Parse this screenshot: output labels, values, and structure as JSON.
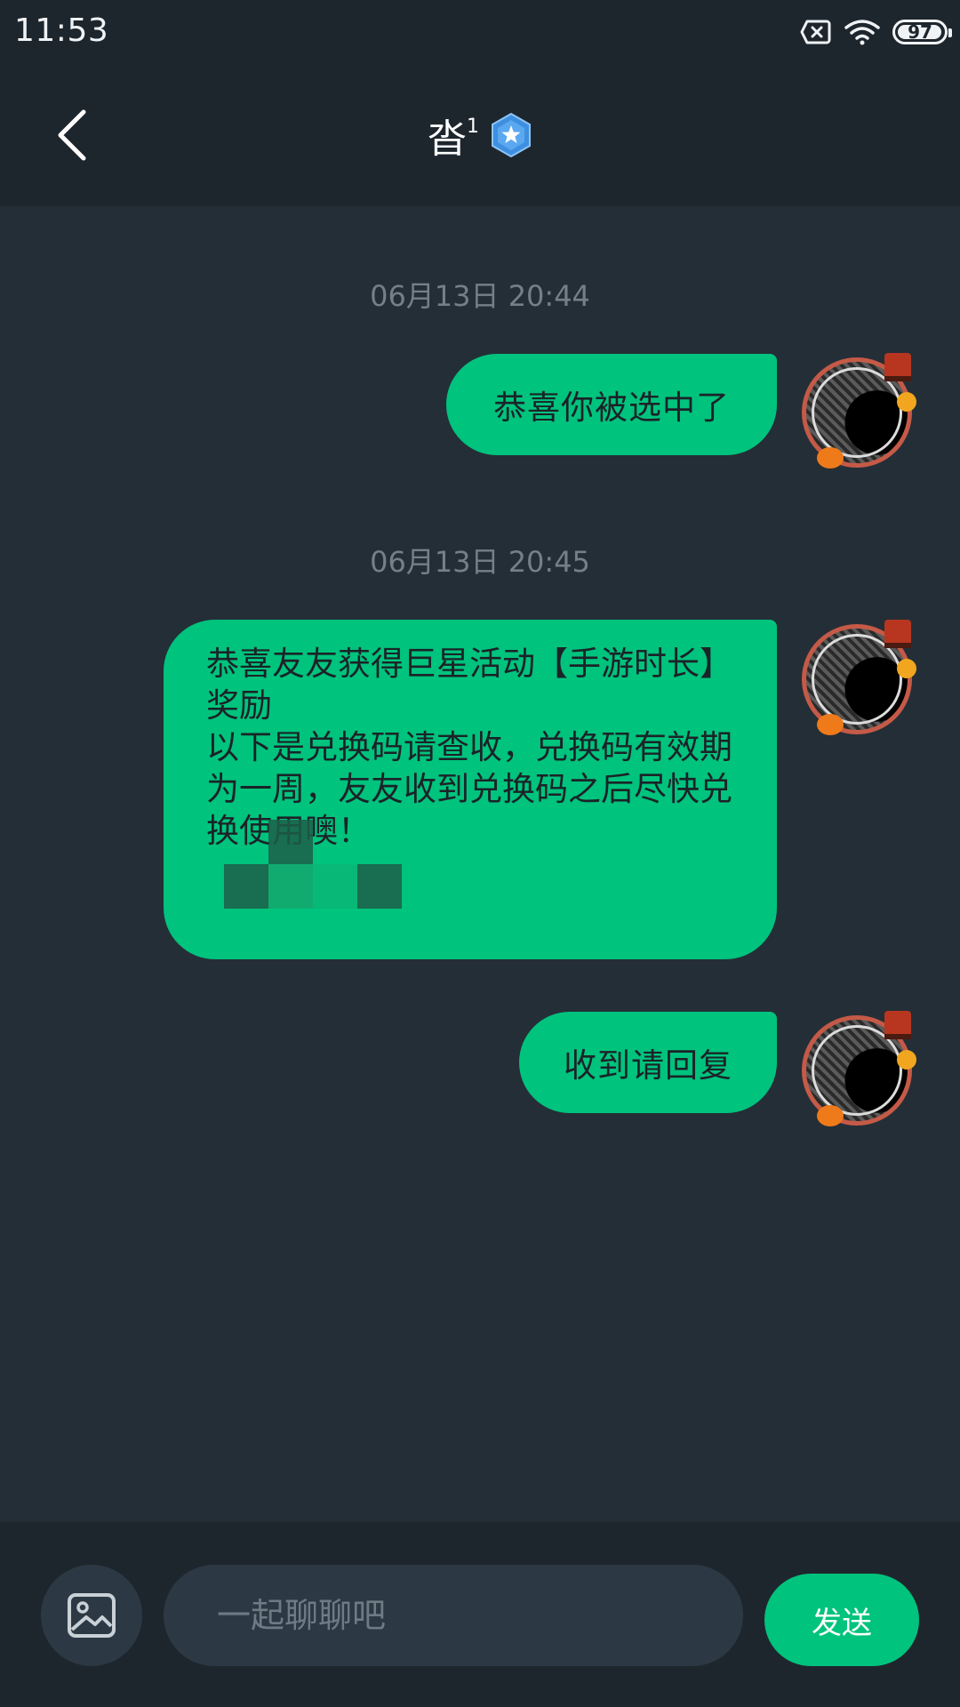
{
  "status_bar": {
    "time": "11:53",
    "battery_level": "97",
    "icons": [
      "sim-error-icon",
      "wifi-icon",
      "battery-icon"
    ]
  },
  "header": {
    "title": "沓",
    "title_superscript": "1",
    "icons": [
      "back-arrow-icon",
      "star-badge-icon"
    ]
  },
  "messages": [
    {
      "timestamp": "06月13日 20:44",
      "text": "恭喜你被选中了"
    },
    {
      "timestamp": "06月13日 20:45",
      "text": "恭喜友友获得巨星活动【手游时长】奖励\n以下是兑换码请查收，兑换码有效期为一周，友友收到兑换码之后尽快兑换使用噢！"
    },
    {
      "timestamp": "",
      "text": "收到请回复"
    }
  ],
  "composer": {
    "placeholder": "一起聊聊吧",
    "send_label": "发送",
    "icons": [
      "image-icon"
    ]
  },
  "colors": {
    "background": "#242e37",
    "bar": "#1e262d",
    "accent": "#00c37d"
  }
}
